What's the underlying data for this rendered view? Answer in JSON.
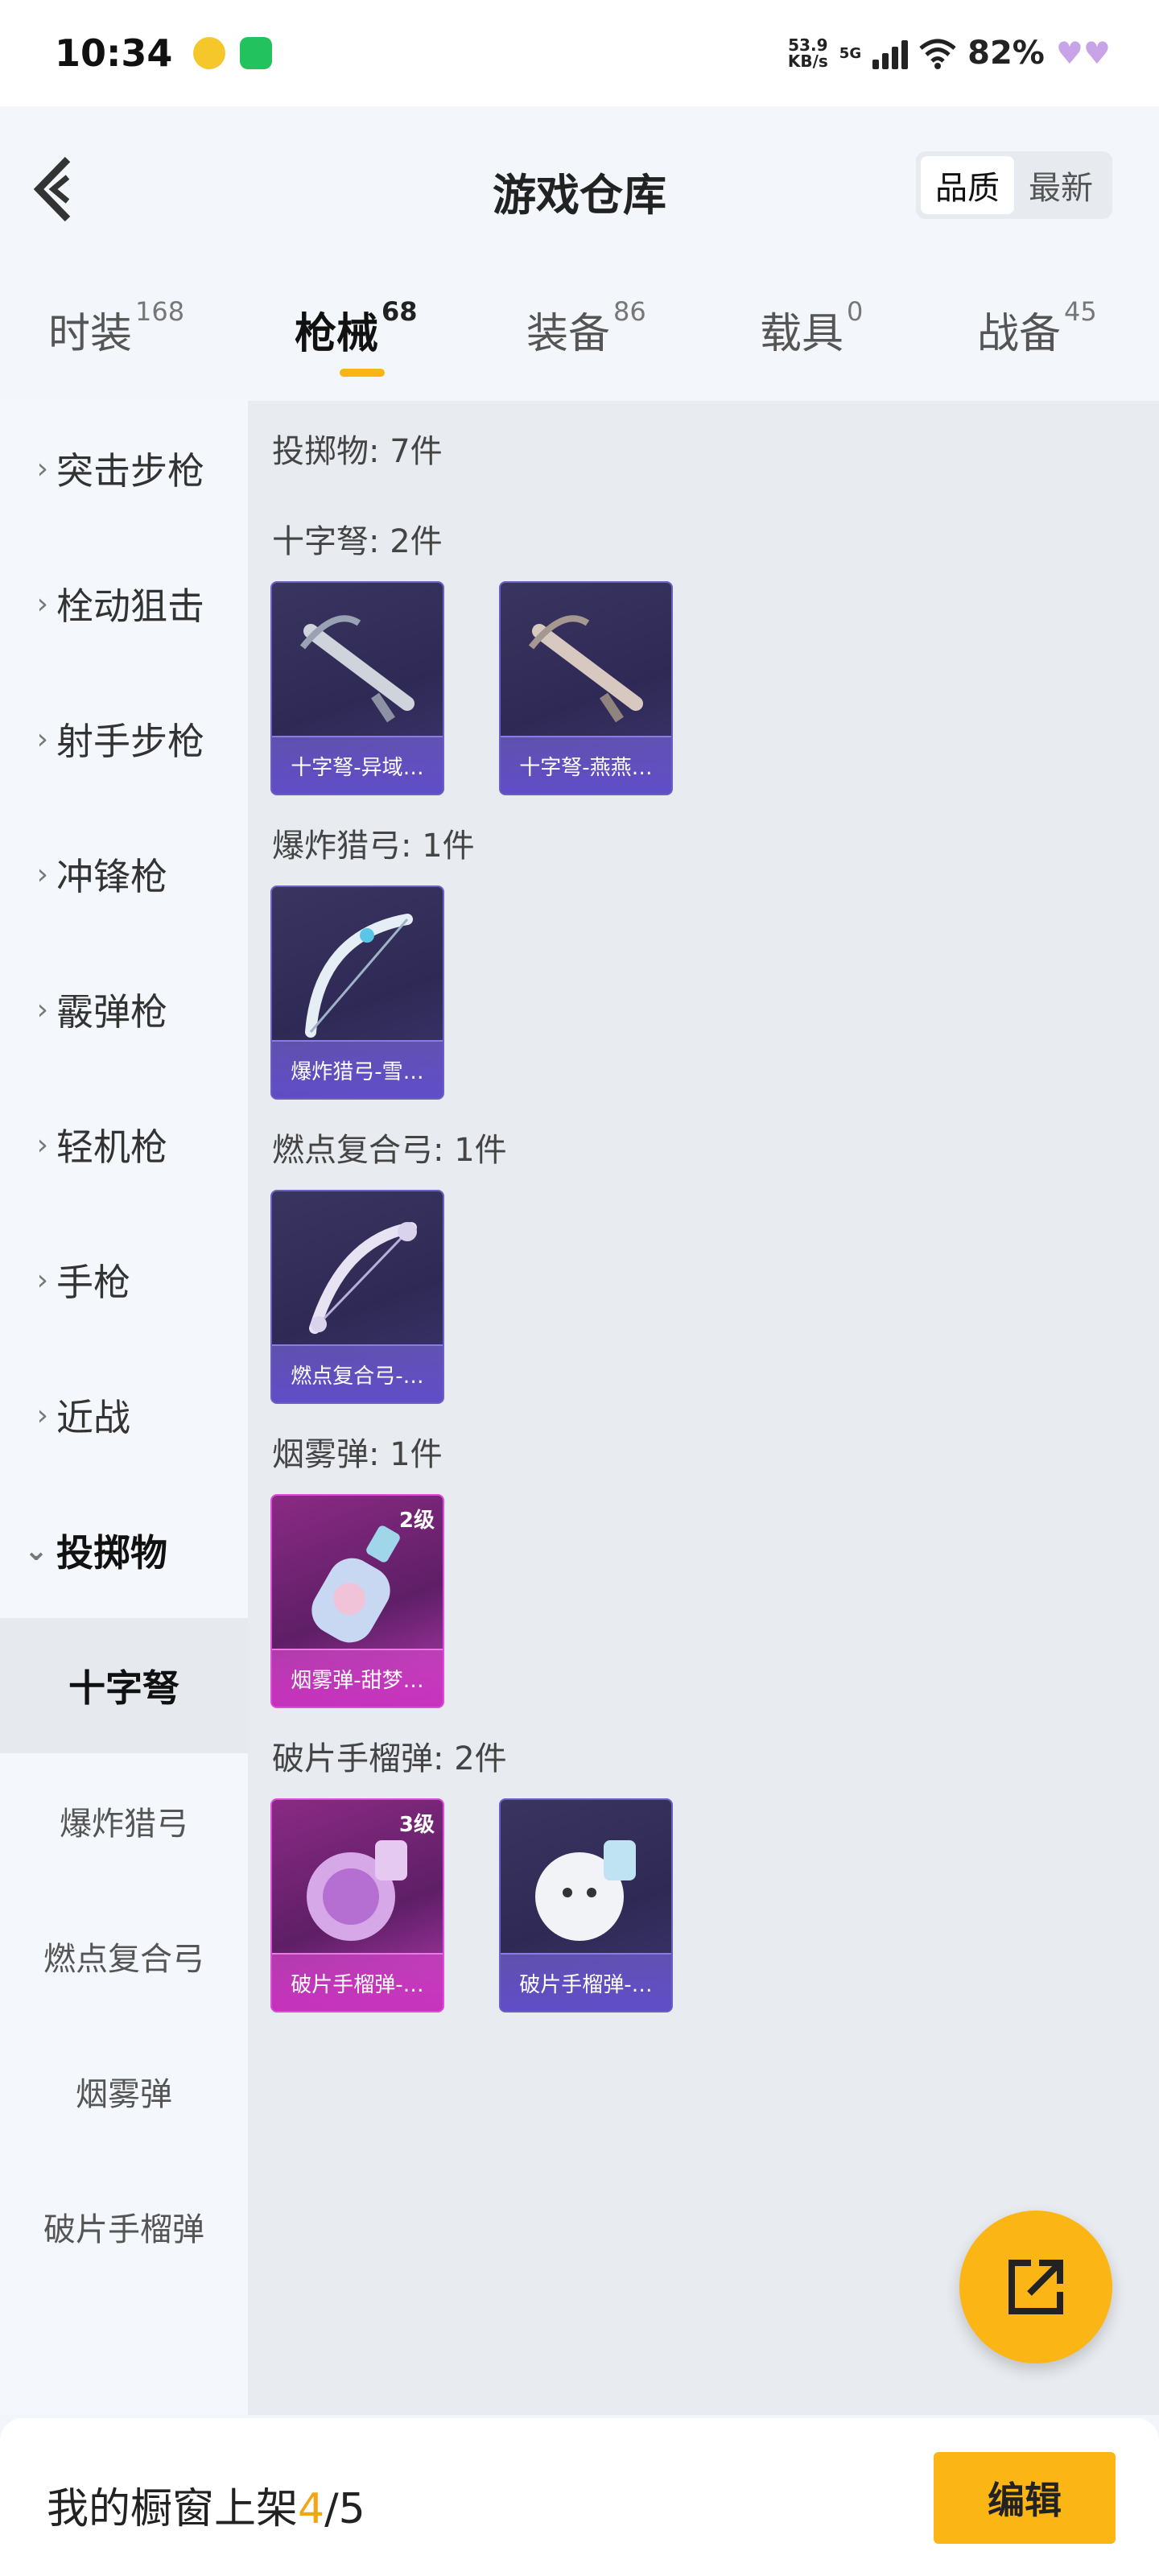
{
  "status_bar": {
    "time": "10:34",
    "net_speed_value": "53.9",
    "net_speed_unit": "KB/s",
    "network": "5G",
    "battery": "82%"
  },
  "header": {
    "title": "游戏仓库",
    "sort_options": [
      "品质",
      "最新"
    ],
    "active_sort": "品质"
  },
  "tabs": [
    {
      "label": "时装",
      "count": "168"
    },
    {
      "label": "枪械",
      "count": "68",
      "active": true
    },
    {
      "label": "装备",
      "count": "86"
    },
    {
      "label": "载具",
      "count": "0"
    },
    {
      "label": "战备",
      "count": "45"
    }
  ],
  "sidebar": {
    "categories": [
      "突击步枪",
      "栓动狙击",
      "射手步枪",
      "冲锋枪",
      "霰弹枪",
      "轻机枪",
      "手枪",
      "近战",
      "投掷物"
    ],
    "expanded": "投掷物",
    "subitems": [
      "十字弩",
      "爆炸猎弓",
      "燃点复合弓",
      "烟雾弹",
      "破片手榴弹"
    ],
    "active_sub": "十字弩"
  },
  "content": {
    "header": "投掷物: 7件",
    "sections": [
      {
        "label": "十字弩: 2件",
        "items": [
          {
            "name": "十字弩-异域…",
            "rarity": "purple",
            "icon": "crossbow-icon"
          },
          {
            "name": "十字弩-燕燕…",
            "rarity": "purple",
            "icon": "crossbow-icon"
          }
        ]
      },
      {
        "label": "爆炸猎弓: 1件",
        "items": [
          {
            "name": "爆炸猎弓-雪…",
            "rarity": "purple",
            "icon": "bow-icon"
          }
        ]
      },
      {
        "label": "燃点复合弓: 1件",
        "items": [
          {
            "name": "燃点复合弓-…",
            "rarity": "purple",
            "icon": "compound-bow-icon"
          }
        ]
      },
      {
        "label": "烟雾弹: 1件",
        "items": [
          {
            "name": "烟雾弹-甜梦…",
            "rarity": "pink",
            "level": "2级",
            "icon": "smoke-bottle-icon"
          }
        ]
      },
      {
        "label": "破片手榴弹: 2件",
        "items": [
          {
            "name": "破片手榴弹-…",
            "rarity": "pink",
            "level": "3级",
            "icon": "grenade-icon"
          },
          {
            "name": "破片手榴弹-…",
            "rarity": "purple",
            "icon": "grenade-icon"
          }
        ]
      }
    ]
  },
  "bottom": {
    "shelf_prefix": "我的橱窗上架",
    "shelf_current": "4",
    "shelf_total": "/5",
    "edit_label": "编辑"
  },
  "colors": {
    "accent": "#fbb515",
    "purple_card": "#3a3560",
    "pink_card": "#8a2a84"
  }
}
